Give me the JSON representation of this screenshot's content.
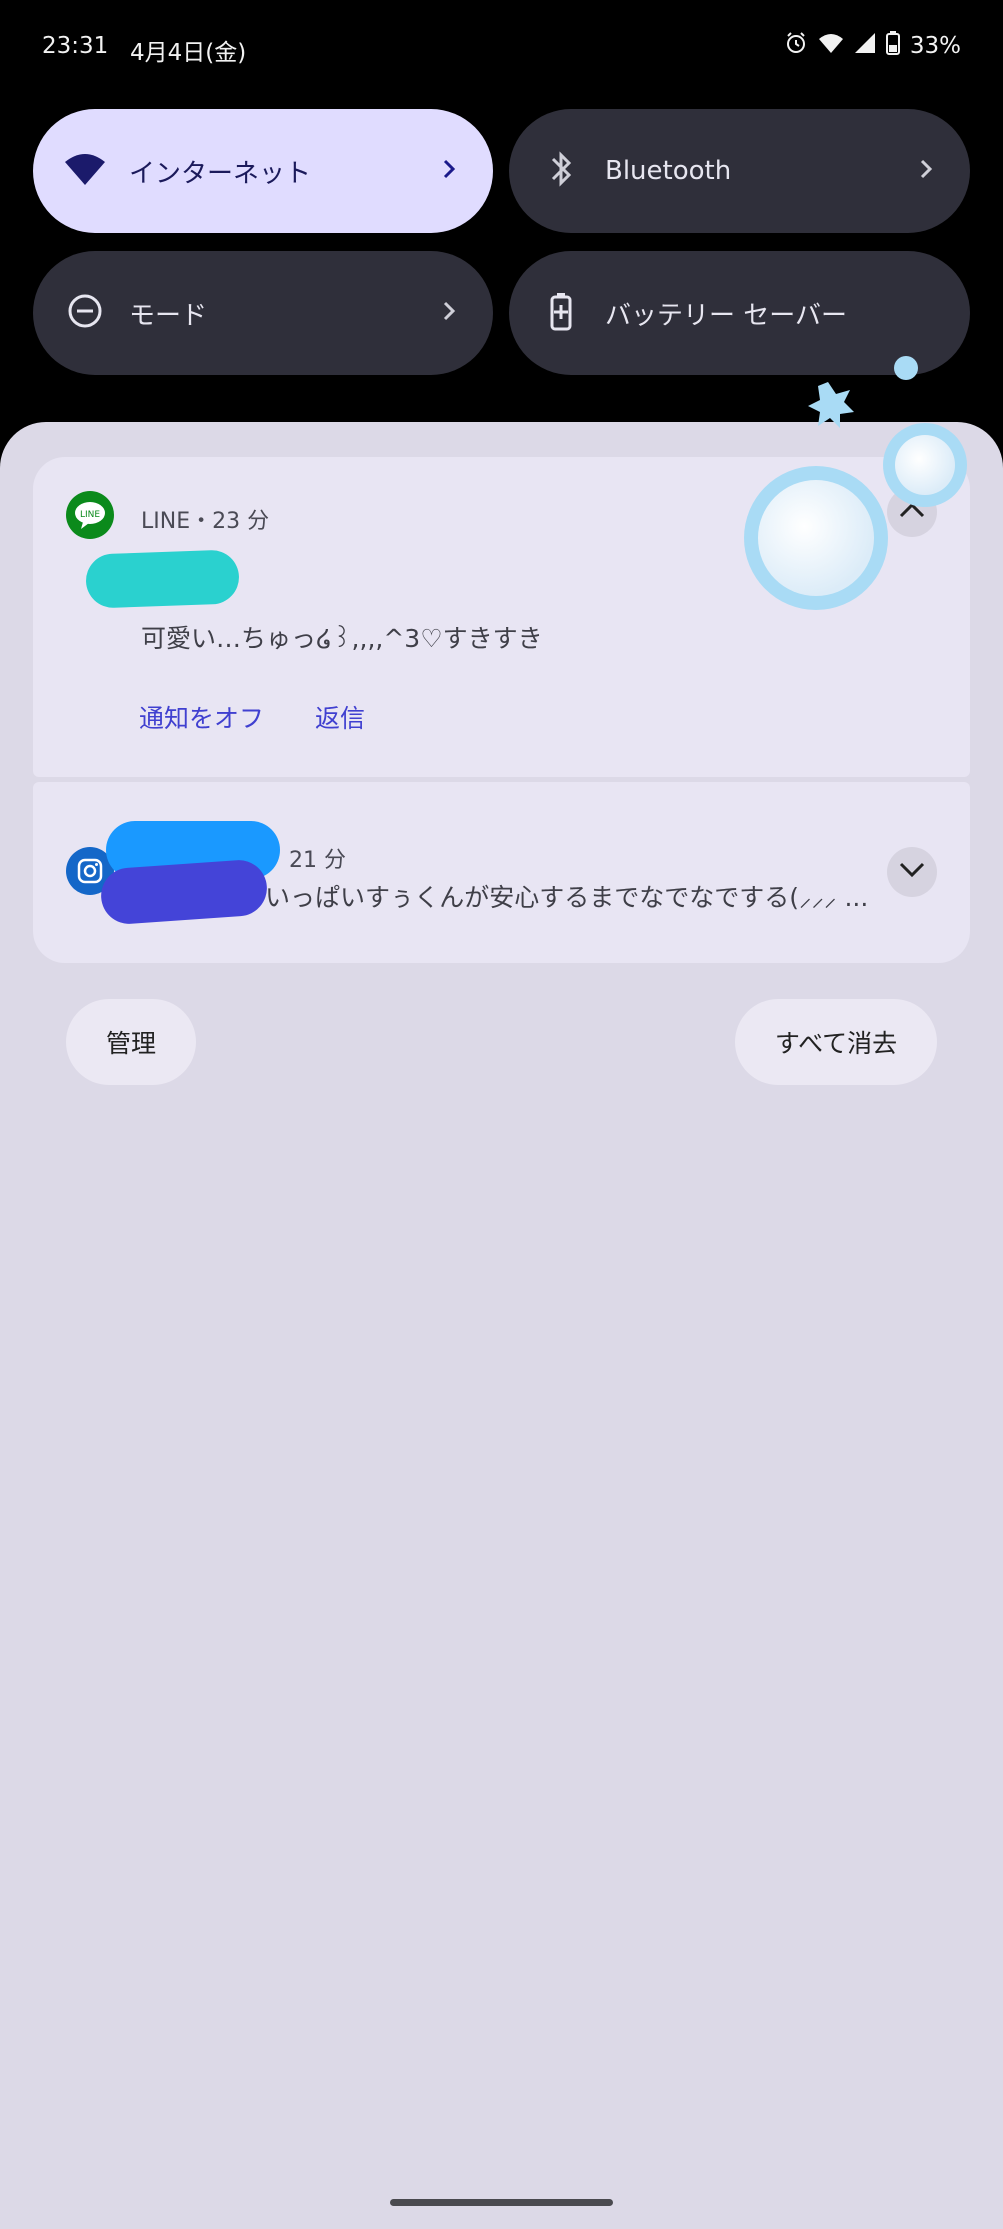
{
  "status_bar": {
    "time": "23:31",
    "date": "4月4日(金)",
    "battery": "33%",
    "icons": [
      "alarm-icon",
      "wifi-icon",
      "signal-icon",
      "battery-icon"
    ]
  },
  "quick_tiles": [
    {
      "label": "インターネット",
      "icon": "wifi-icon",
      "active": true
    },
    {
      "label": "Bluetooth",
      "icon": "bluetooth-icon",
      "active": false
    },
    {
      "label": "モード",
      "icon": "do-not-disturb-icon",
      "active": false
    },
    {
      "label": "バッテリー セーバー",
      "icon": "battery-saver-icon",
      "active": false
    }
  ],
  "notifications": [
    {
      "app": "LINE",
      "meta": "LINE・23 分",
      "message": "可愛い…ちゅっ໒꒱,,,,^3♡すきすき",
      "actions": [
        "通知をオフ",
        "返信"
      ],
      "expanded": true
    },
    {
      "app": "Instagram",
      "meta": "21 分",
      "message": "いっぱいすぅくんが安心するまでなでなでする(⸝⸝⸝ ...",
      "expanded": false
    }
  ],
  "footer": {
    "manage": "管理",
    "clear_all": "すべて消去"
  },
  "colors": {
    "active_tile": "#e0dcff",
    "dark_tile": "#2f2f3a",
    "shade": "#dcd9e7",
    "accent": "#4040d0"
  }
}
